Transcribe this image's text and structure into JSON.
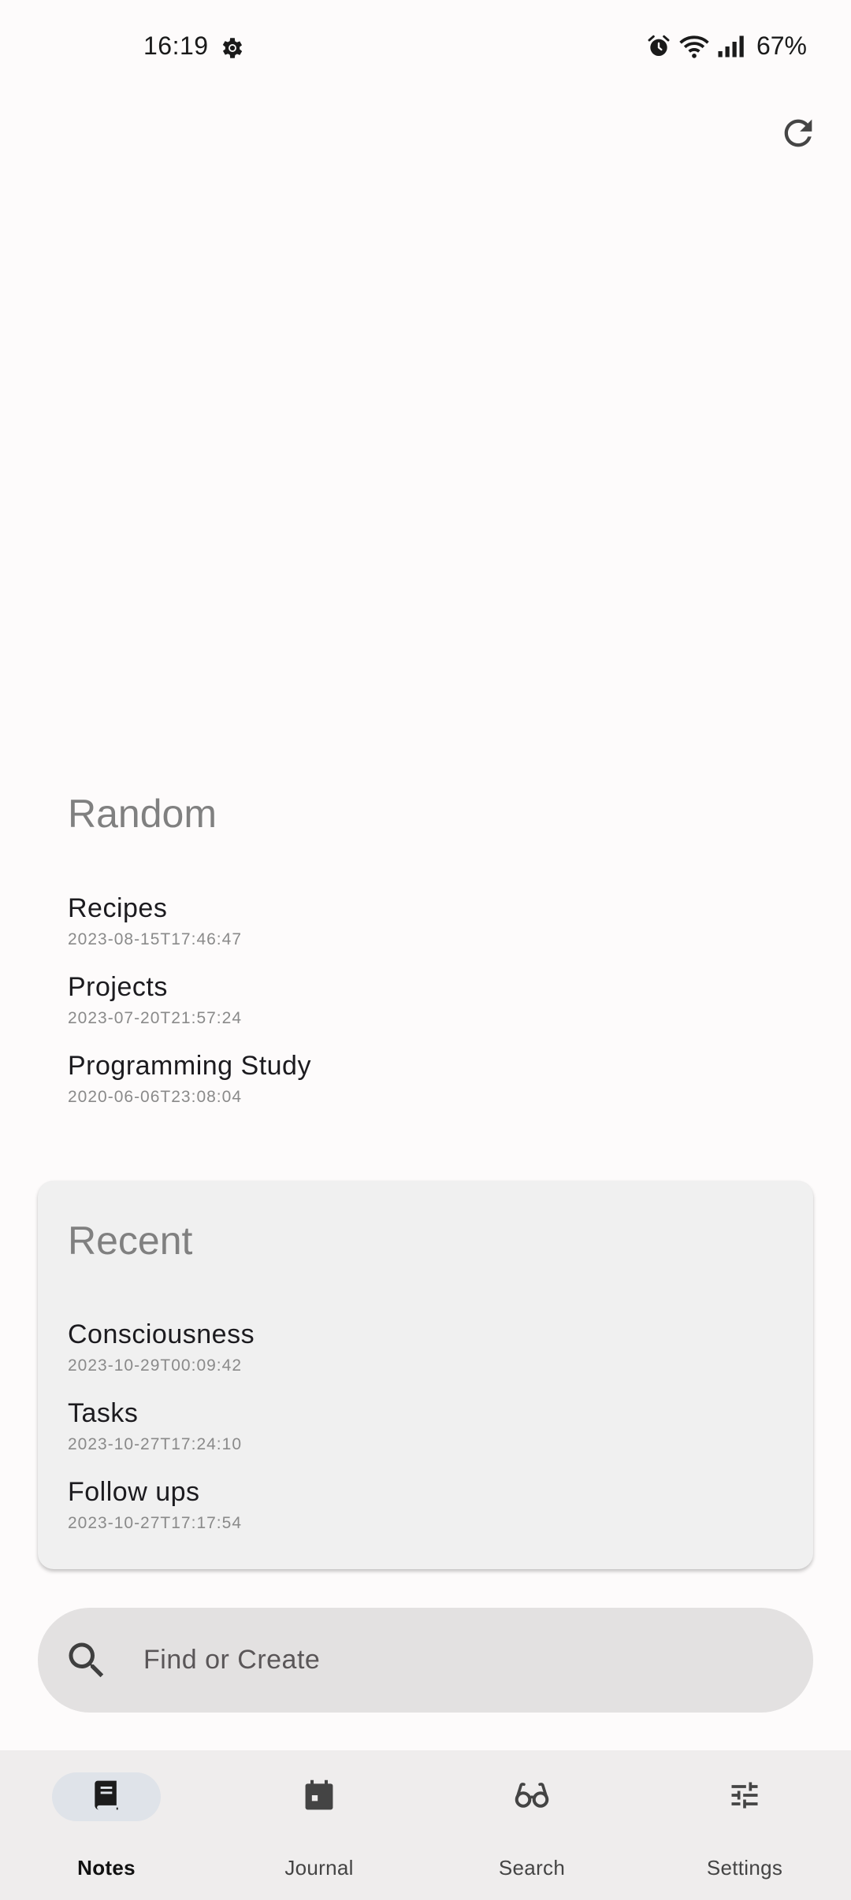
{
  "status_bar": {
    "time": "16:19",
    "battery": "67%",
    "icons": [
      "settings-gear-icon",
      "alarm-icon",
      "wifi-icon",
      "signal-icon"
    ]
  },
  "toolbar": {
    "refresh_icon": "refresh-icon"
  },
  "random": {
    "title": "Random",
    "items": [
      {
        "title": "Recipes",
        "date": "2023-08-15T17:46:47"
      },
      {
        "title": "Projects",
        "date": "2023-07-20T21:57:24"
      },
      {
        "title": "Programming Study",
        "date": "2020-06-06T23:08:04"
      }
    ]
  },
  "recent": {
    "title": "Recent",
    "items": [
      {
        "title": "Consciousness",
        "date": "2023-10-29T00:09:42"
      },
      {
        "title": "Tasks",
        "date": "2023-10-27T17:24:10"
      },
      {
        "title": "Follow ups",
        "date": "2023-10-27T17:17:54"
      }
    ]
  },
  "search": {
    "placeholder": "Find or Create",
    "value": ""
  },
  "nav": {
    "items": [
      {
        "label": "Notes",
        "icon": "book-icon",
        "active": true
      },
      {
        "label": "Journal",
        "icon": "calendar-icon",
        "active": false
      },
      {
        "label": "Search",
        "icon": "glasses-icon",
        "active": false
      },
      {
        "label": "Settings",
        "icon": "sliders-icon",
        "active": false
      }
    ]
  },
  "colors": {
    "background": "#fdfbfb",
    "card": "#f0f0f0",
    "search_bar": "#e3e1e1",
    "nav_background": "#efeded",
    "active_pill": "#dfe3e9",
    "section_title": "#808080"
  }
}
